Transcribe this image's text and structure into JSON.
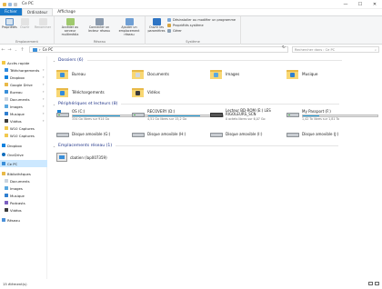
{
  "window": {
    "title": "Ce PC",
    "minimize": "—",
    "maximize": "☐",
    "close": "✕"
  },
  "ribbon_tabs": [
    "Fichier",
    "Ordinateur",
    "Affichage"
  ],
  "ribbon": {
    "groups": {
      "emplacement": "Emplacement",
      "reseau": "Réseau",
      "systeme": "Système"
    },
    "buttons": {
      "proprietes": "Propriétés",
      "ouvrir": "Ouvrir",
      "renommer": "Renommer",
      "acceder_media": "Accéder au serveur multimédia",
      "connecter_lecteur": "Connecter un lecteur réseau",
      "ajouter_emplacement": "Ajouter un emplacement réseau",
      "ouvrir_parametres": "Ouvrir les paramètres",
      "desinstaller": "Désinstaller ou modifier un programme",
      "proprietes_systeme": "Propriétés système",
      "gerer": "Gérer"
    }
  },
  "address": {
    "path": "Ce PC",
    "search_placeholder": "Rechercher dans : Ce PC"
  },
  "sidebar": {
    "items": [
      {
        "label": "Accès rapide",
        "pinned": false
      },
      {
        "label": "Téléchargements",
        "pinned": true
      },
      {
        "label": "Dropbox",
        "pinned": true
      },
      {
        "label": "Google Drive",
        "pinned": true
      },
      {
        "label": "Bureau",
        "pinned": true
      },
      {
        "label": "Documents",
        "pinned": true
      },
      {
        "label": "Images",
        "pinned": true
      },
      {
        "label": "Musique",
        "pinned": true
      },
      {
        "label": "Vidéos",
        "pinned": true
      },
      {
        "label": "W10 Captures",
        "pinned": false
      },
      {
        "label": "W10 Captures",
        "pinned": false
      },
      {
        "label": "Dropbox",
        "pinned": false
      },
      {
        "label": "OneDrive",
        "pinned": false
      },
      {
        "label": "Ce PC",
        "pinned": false
      },
      {
        "label": "Bibliothèques",
        "pinned": false
      },
      {
        "label": "Documents",
        "pinned": false
      },
      {
        "label": "Images",
        "pinned": false
      },
      {
        "label": "Musique",
        "pinned": false
      },
      {
        "label": "Podcasts",
        "pinned": false
      },
      {
        "label": "Vidéos",
        "pinned": false
      },
      {
        "label": "Réseau",
        "pinned": false
      }
    ]
  },
  "sections": {
    "folders_title": "Dossiers (6)",
    "devices_title": "Périphériques et lecteurs (8)",
    "network_title": "Emplacements réseau (1)"
  },
  "folders": [
    {
      "name": "Bureau",
      "badge": "#3a8fd9"
    },
    {
      "name": "Documents",
      "badge": "#d0d7df"
    },
    {
      "name": "Images",
      "badge": "#5aa8e0"
    },
    {
      "name": "Musique",
      "badge": "#2f7fd0"
    },
    {
      "name": "Téléchargements",
      "badge": "#2f8be0"
    },
    {
      "name": "Vidéos",
      "badge": "#3b3b3b"
    }
  ],
  "drives": [
    {
      "name": "OS (C:)",
      "free": "334 Go libres sur 914 Go",
      "used_pct": 63,
      "has_bar": true,
      "windows": true
    },
    {
      "name": "RECOVERY (D:)",
      "free": "4,51 Go libres sur 15,2 Go",
      "used_pct": 70,
      "has_bar": true,
      "windows": false
    },
    {
      "name": "Lecteur BD-ROM (E:) LES RIGOLEURS_SCN",
      "free": "0 octets libres sur 6,07 Go",
      "used_pct": 100,
      "has_bar": true,
      "windows": false
    },
    {
      "name": "My Passport (F:)",
      "free": "1,42 To libres sur 1,81 To",
      "used_pct": 22,
      "has_bar": true,
      "windows": false
    },
    {
      "name": "Disque amovible (G:)",
      "free": "",
      "used_pct": 0,
      "has_bar": false,
      "windows": false
    },
    {
      "name": "Disque amovible (H:)",
      "free": "",
      "used_pct": 0,
      "has_bar": false,
      "windows": false
    },
    {
      "name": "Disque amovible (I:)",
      "free": "",
      "used_pct": 0,
      "has_bar": false,
      "windows": false
    },
    {
      "name": "Disque amovible (J:)",
      "free": "",
      "used_pct": 0,
      "has_bar": false,
      "windows": false
    }
  ],
  "network_locations": [
    {
      "name": "cbatien (lap007359)"
    }
  ],
  "status": {
    "count": "15 élément(s)"
  },
  "colors": {
    "accent": "#1979ca",
    "selected": "#cce8ff",
    "section_title": "#1e3287",
    "bar_fill": "#26a0da"
  }
}
